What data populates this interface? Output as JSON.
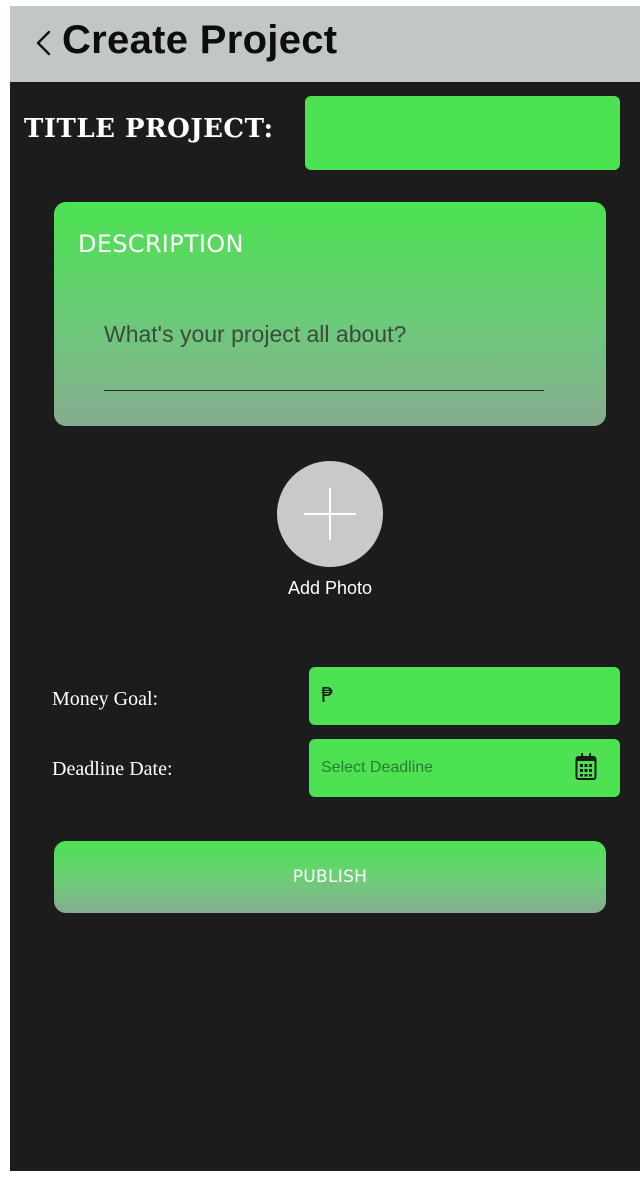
{
  "header": {
    "title": "Create Project",
    "back_icon": "chevron-left-icon"
  },
  "title_project": {
    "label": "TITLE PROJECT:",
    "value": ""
  },
  "description": {
    "heading": "DESCRIPTION",
    "placeholder": "What's your project all about?",
    "value": ""
  },
  "add_photo": {
    "icon": "plus-icon",
    "label": "Add Photo"
  },
  "money_goal": {
    "label": "Money Goal:",
    "currency_symbol": "₱",
    "value": ""
  },
  "deadline": {
    "label": "Deadline Date:",
    "placeholder": "Select Deadline",
    "icon": "calendar-icon"
  },
  "publish": {
    "label": "PUBLISH"
  },
  "colors": {
    "accent_green": "#4ce251",
    "header_gray": "#c1c7c7",
    "background": "#1c1c1c"
  }
}
